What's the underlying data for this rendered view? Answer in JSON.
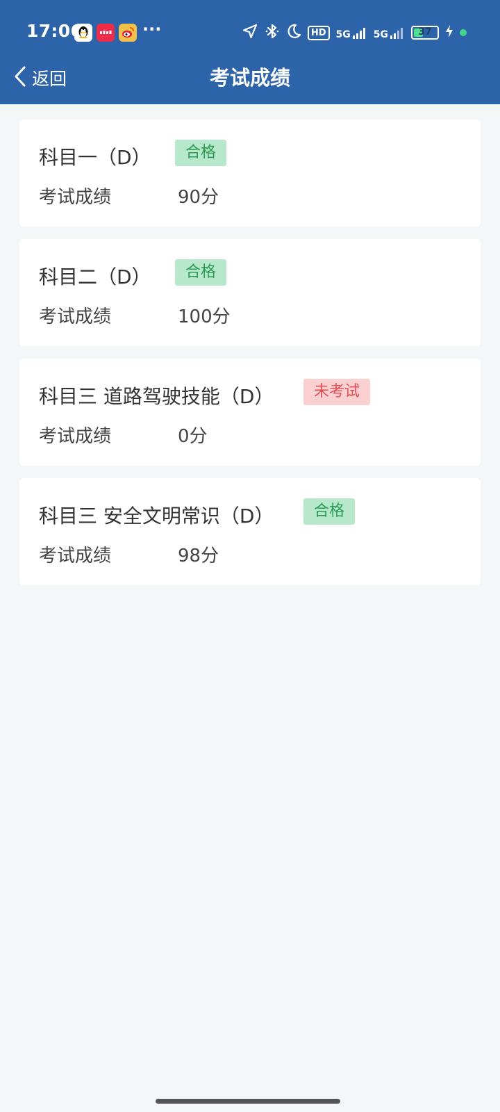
{
  "status_bar": {
    "time": "17:06",
    "more": "···",
    "hd_label": "HD",
    "signal1_label": "5G",
    "signal2_label": "5G",
    "battery_level": "37"
  },
  "nav": {
    "back_label": "返回",
    "title": "考试成绩"
  },
  "colors": {
    "header_bg": "#2d64a9",
    "pass_bg": "#b7e8cb",
    "pass_text": "#2b9a54",
    "fail_bg": "#fbd0d1",
    "fail_text": "#e05056"
  },
  "results": [
    {
      "subject": "科目一（D）",
      "status": "合格",
      "score_label": "考试成绩",
      "score": "90分"
    },
    {
      "subject": "科目二（D）",
      "status": "合格",
      "score_label": "考试成绩",
      "score": "100分"
    },
    {
      "subject": "科目三 道路驾驶技能（D）",
      "status": "未考试",
      "score_label": "考试成绩",
      "score": "0分"
    },
    {
      "subject": "科目三 安全文明常识（D）",
      "status": "合格",
      "score_label": "考试成绩",
      "score": "98分"
    }
  ]
}
